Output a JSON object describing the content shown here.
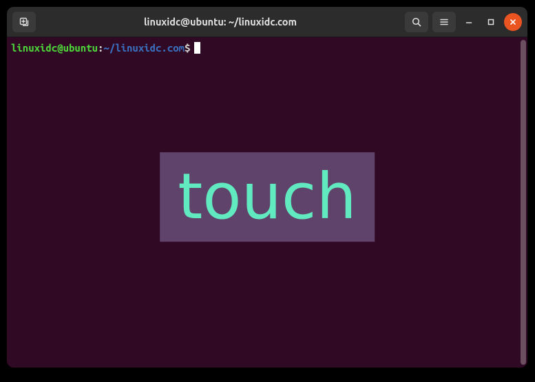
{
  "titlebar": {
    "title": "linuxidc@ubuntu: ~/linuxidc.com"
  },
  "prompt": {
    "user_host": "linuxidc@ubuntu",
    "colon": ":",
    "path": "~/linuxidc.com",
    "dollar": "$"
  },
  "overlay": {
    "text": "touch"
  }
}
